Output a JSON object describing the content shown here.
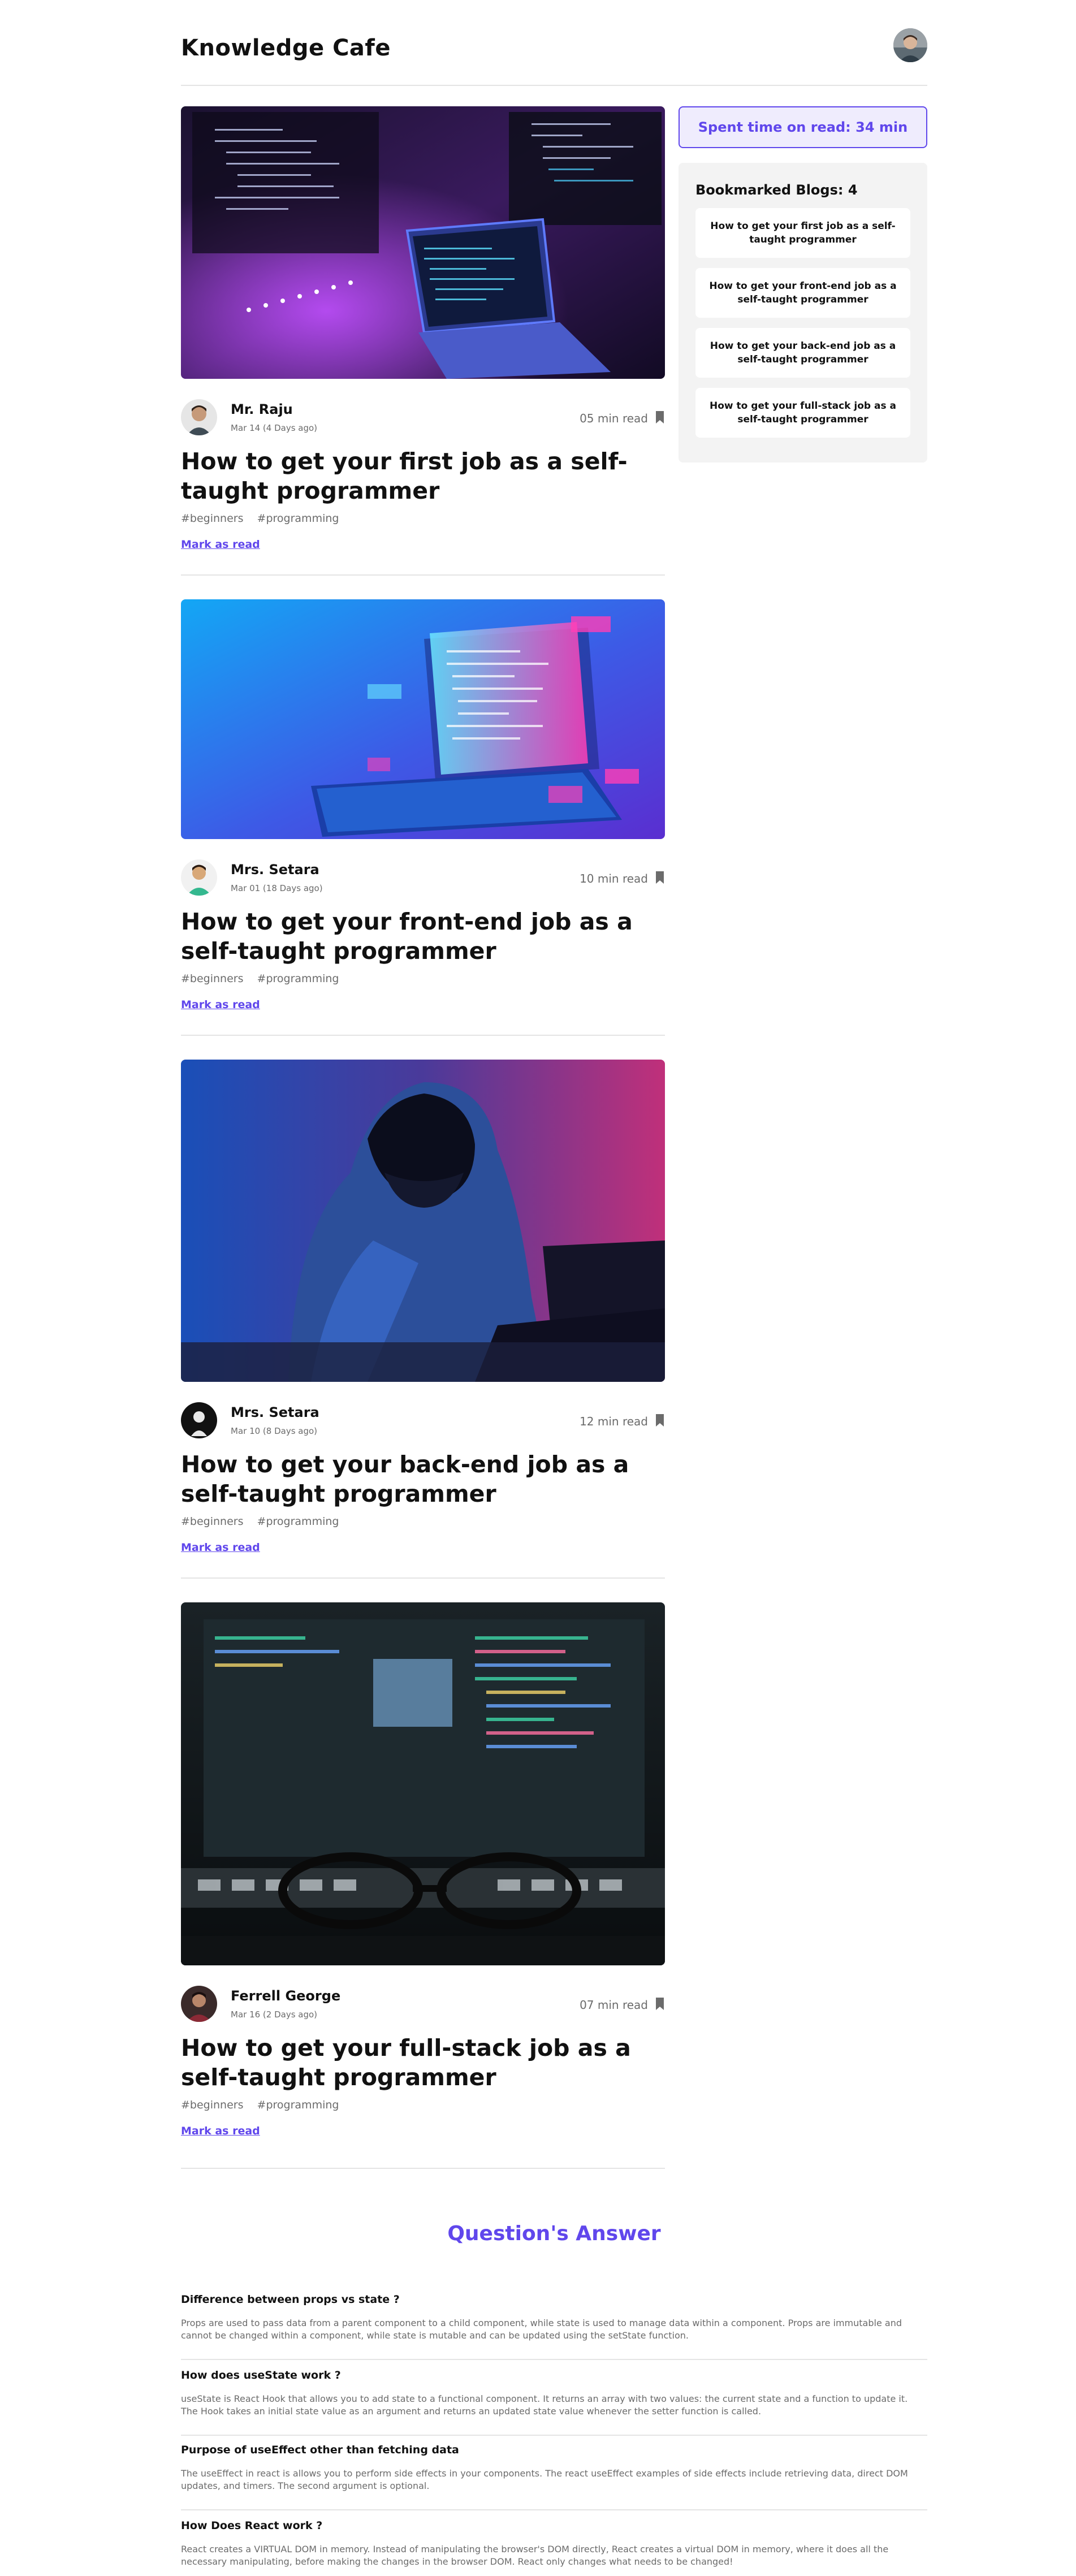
{
  "header": {
    "brand": "Knowledge Cafe",
    "avatar_icon": "user-avatar-icon"
  },
  "blogs": [
    {
      "author": "Mr. Raju",
      "date": "Mar 14 (4 Days ago)",
      "read_time": "05 min read",
      "title": "How to get your first job as a self-taught programmer",
      "tags": [
        "#beginners",
        "#programming"
      ],
      "mark_read": "Mark as read",
      "cover_theme": "purple-laptop-code"
    },
    {
      "author": "Mrs. Setara",
      "date": "Mar 01 (18 Days ago)",
      "read_time": "10 min read",
      "title": "How to get your front-end job as a self-taught programmer",
      "tags": [
        "#beginners",
        "#programming"
      ],
      "mark_read": "Mark as read",
      "cover_theme": "blue-laptop-illustration"
    },
    {
      "author": "Mrs. Setara",
      "date": "Mar 10 (8 Days ago)",
      "read_time": "12 min read",
      "title": "How to get your back-end job as a self-taught programmer",
      "tags": [
        "#beginners",
        "#programming"
      ],
      "mark_read": "Mark as read",
      "cover_theme": "hooded-coder"
    },
    {
      "author": "Ferrell George",
      "date": "Mar 16 (2 Days ago)",
      "read_time": "07 min read",
      "title": "How to get your full-stack job as a self-taught programmer",
      "tags": [
        "#beginners",
        "#programming"
      ],
      "mark_read": "Mark as read",
      "cover_theme": "glasses-monitor"
    }
  ],
  "sidebar": {
    "spent_time": "Spent time on read: 34 min",
    "bookmarks_title": "Bookmarked Blogs: 4",
    "bookmarks": [
      "How to get your first job as a self-taught programmer",
      "How to get your front-end job as a self-taught programmer",
      "How to get your back-end job as a self-taught programmer",
      "How to get your full-stack job as a self-taught programmer"
    ]
  },
  "qa": {
    "heading": "Question's Answer",
    "items": [
      {
        "q": "Difference between props vs state ?",
        "a": "Props are used to pass data from a parent component to a child component, while state is used to manage data within a component. Props are immutable and cannot be changed within a component, while state is mutable and can be updated using the setState function."
      },
      {
        "q": "How does useState work ?",
        "a": "useState is React Hook that allows you to add state to a functional component. It returns an array with two values: the current state and a function to update it. The Hook takes an initial state value as an argument and returns an updated state value whenever the setter function is called."
      },
      {
        "q": "Purpose of useEffect other than fetching data",
        "a": "The useEffect in react is allows you to perform side effects in your components. The react useEffect examples of side effects include retrieving data, direct DOM updates, and timers. The second argument is optional."
      },
      {
        "q": "How Does React work ?",
        "a": "React creates a VIRTUAL DOM in memory. Instead of manipulating the browser's DOM directly, React creates a virtual DOM in memory, where it does all the necessary manipulating, before making the changes in the browser DOM. React only changes what needs to be changed!"
      }
    ]
  },
  "colors": {
    "accent": "#6047ec",
    "accent_bg": "#efecfd",
    "muted": "#6b6b6b",
    "panel": "#f3f3f3"
  }
}
